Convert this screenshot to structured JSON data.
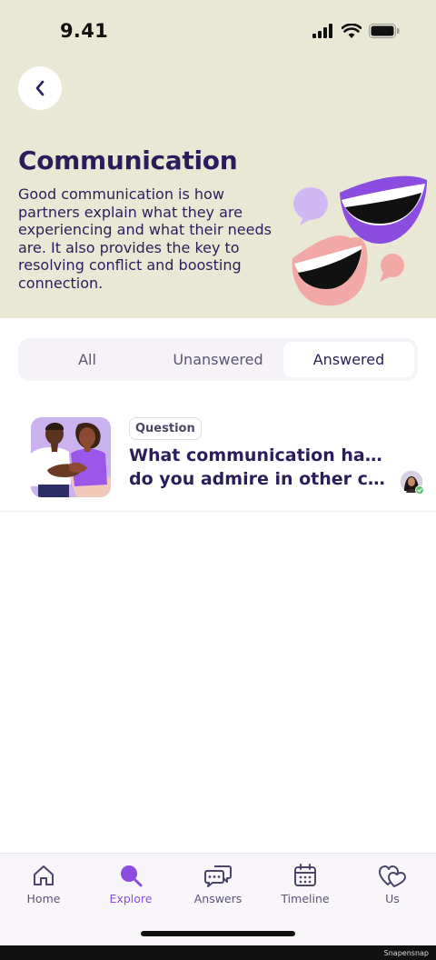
{
  "status_bar": {
    "time": "9.41"
  },
  "header": {
    "title": "Communication",
    "description": "Good communication is how partners explain what they are experiencing and what their needs are. It also provides the key to resolving conflict and boosting connection.",
    "background_color": "#e9e8d5"
  },
  "filter_tabs": {
    "options": [
      "All",
      "Unanswered",
      "Answered"
    ],
    "selected": "Answered"
  },
  "questions": [
    {
      "badge": "Question",
      "title_line1": "What communication habit",
      "title_line2": "do you admire in other cou..."
    }
  ],
  "tab_bar": {
    "items": [
      {
        "label": "Home",
        "icon": "home-icon"
      },
      {
        "label": "Explore",
        "icon": "explore-icon"
      },
      {
        "label": "Answers",
        "icon": "answers-icon"
      },
      {
        "label": "Timeline",
        "icon": "calendar-icon"
      },
      {
        "label": "Us",
        "icon": "hearts-icon"
      }
    ],
    "active": "Explore",
    "accent_color": "#8a4de0"
  },
  "watermark": "Snapensnap"
}
